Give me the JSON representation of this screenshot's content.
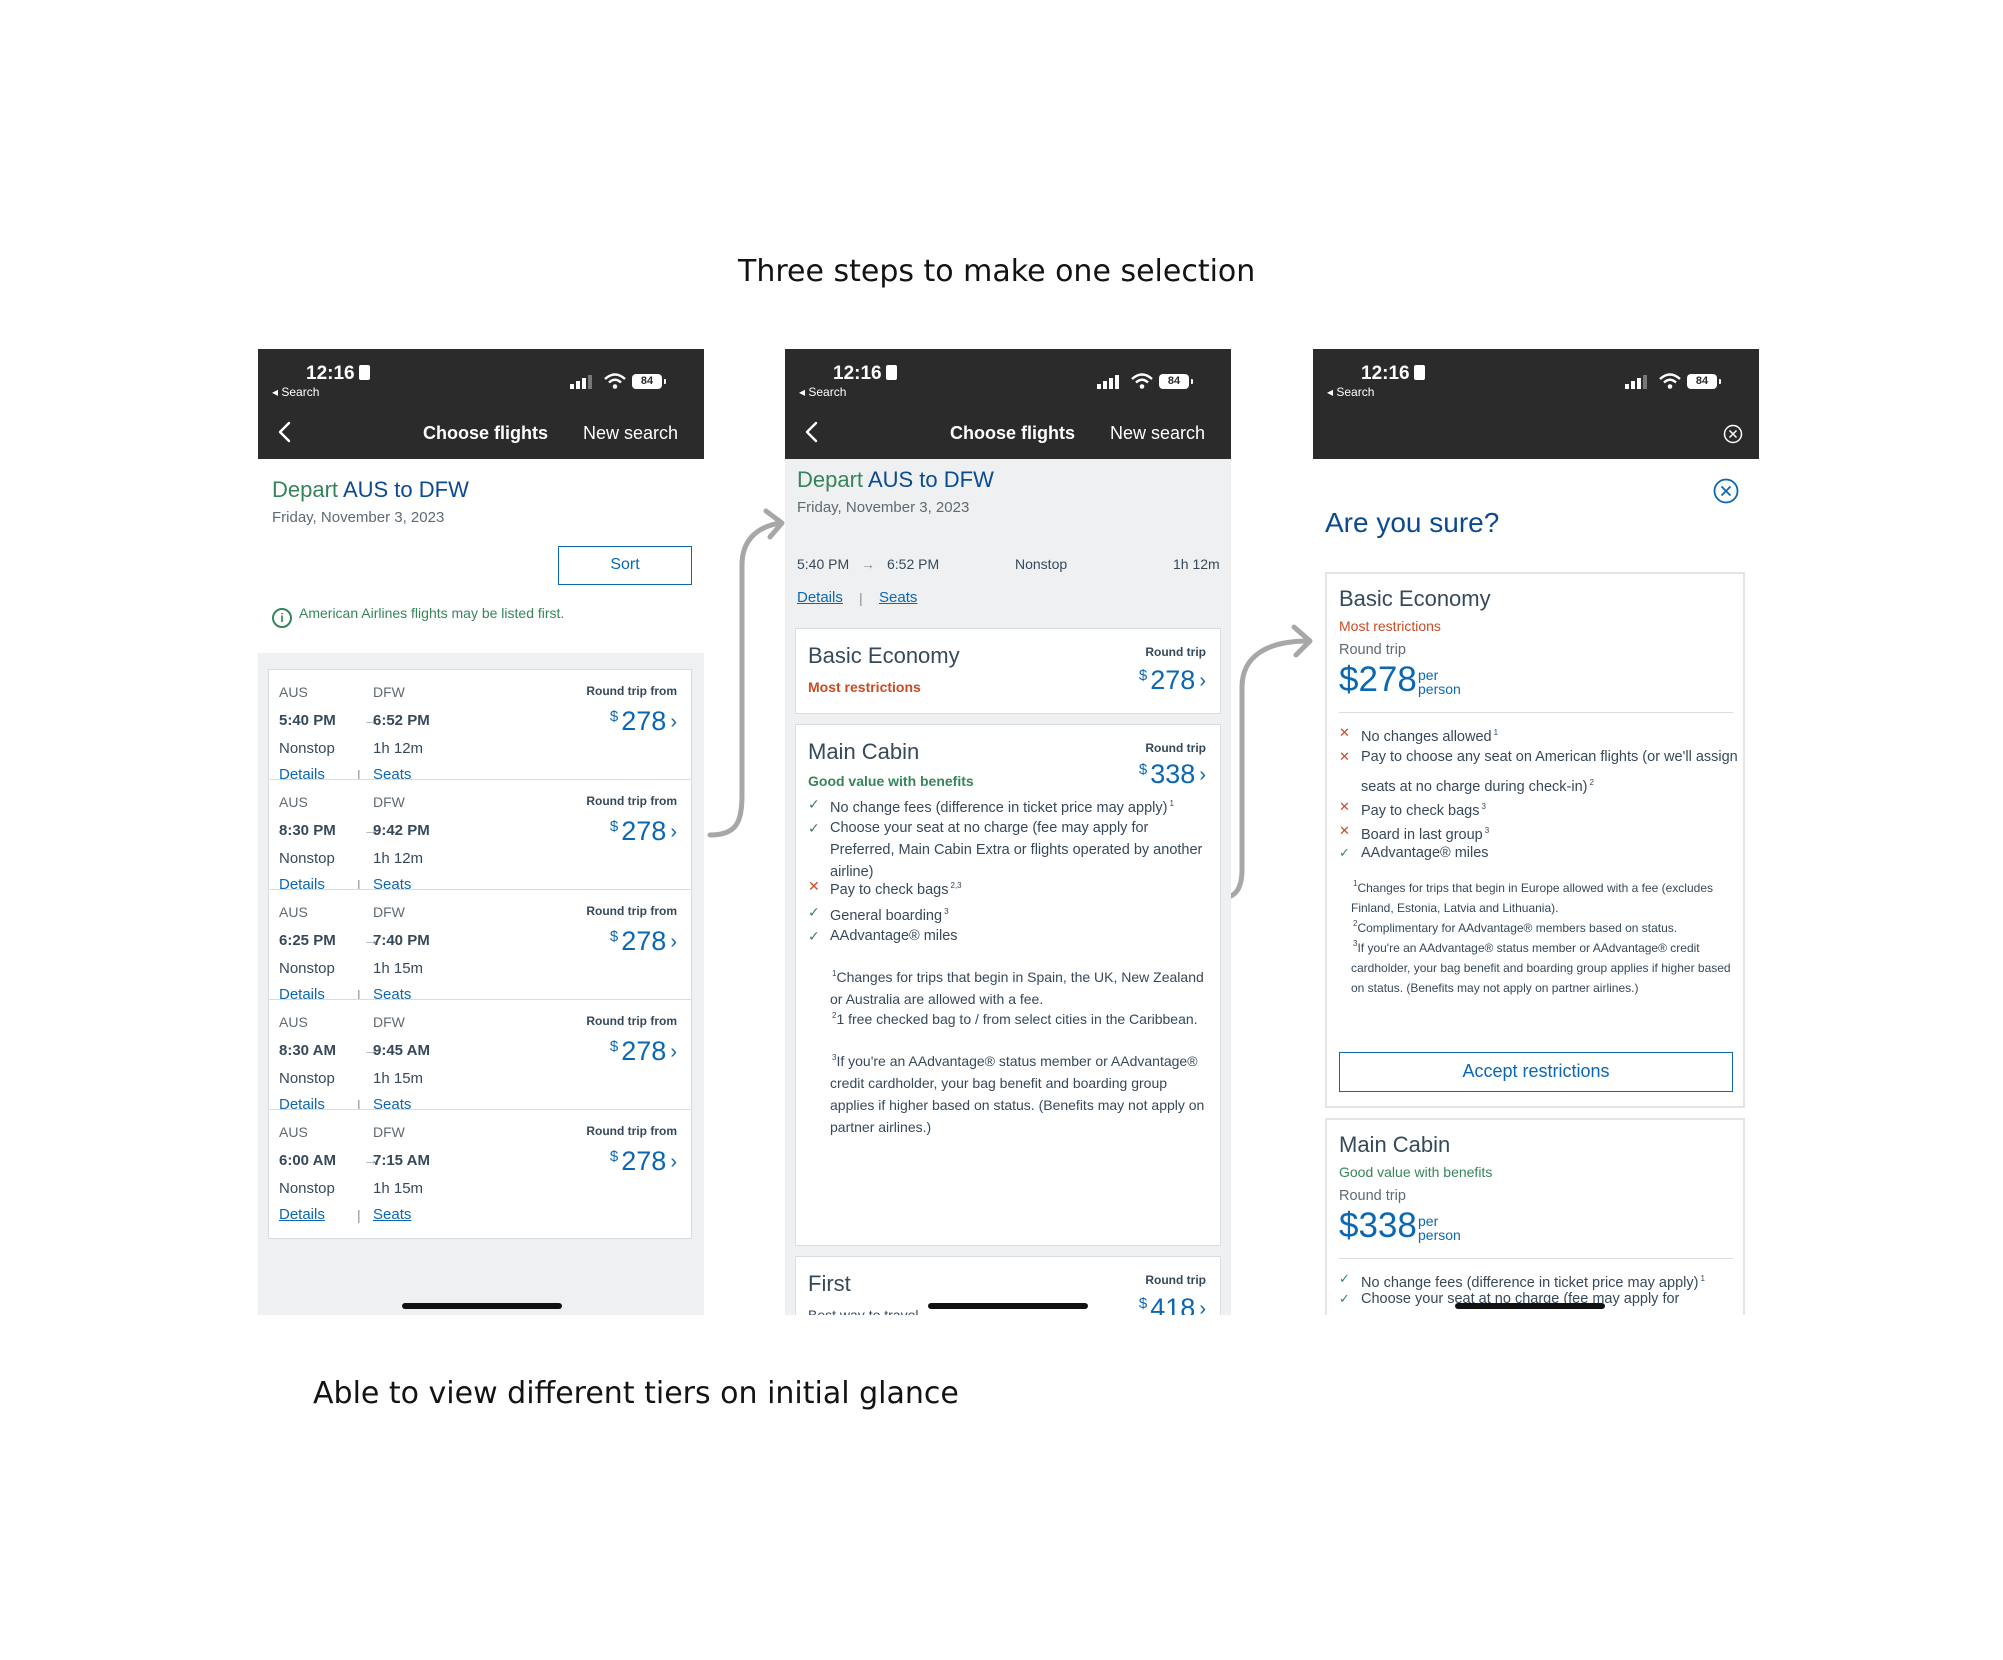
{
  "captions": {
    "top": "Three steps to make one selection",
    "bottom": "Able to view different tiers on initial glance"
  },
  "status_bar": {
    "time": "12:16",
    "back_app": "◂ Search",
    "battery": "84"
  },
  "nav": {
    "title": "Choose flights",
    "new_search": "New search"
  },
  "icons": {
    "back": "chevron-left-icon",
    "close": "close-circle-icon",
    "info": "info-icon",
    "check": "check-icon",
    "cross": "x-icon",
    "arrow": "arrow-right-icon"
  },
  "colors": {
    "accent": "#0b67b2",
    "green": "#36855a",
    "warning": "#c84b24",
    "nav_bg": "#2b2b2b"
  },
  "screen1": {
    "depart_prefix": "Depart",
    "route": "AUS to DFW",
    "date": "Friday, November 3, 2023",
    "sort_label": "Sort",
    "info_text": "American Airlines flights may be listed first.",
    "labels": {
      "from": "AUS",
      "to": "DFW",
      "round_trip": "Round trip from",
      "details": "Details",
      "seats": "Seats",
      "currency": "$",
      "separator": "|"
    },
    "flights": [
      {
        "dep": "5:40 PM",
        "arr": "6:52 PM",
        "stops": "Nonstop",
        "duration": "1h  12m",
        "price": "278"
      },
      {
        "dep": "8:30 PM",
        "arr": "9:42 PM",
        "stops": "Nonstop",
        "duration": "1h  12m",
        "price": "278"
      },
      {
        "dep": "6:25 PM",
        "arr": "7:40 PM",
        "stops": "Nonstop",
        "duration": "1h  15m",
        "price": "278"
      },
      {
        "dep": "8:30 AM",
        "arr": "9:45 AM",
        "stops": "Nonstop",
        "duration": "1h  15m",
        "price": "278"
      },
      {
        "dep": "6:00 AM",
        "arr": "7:15 AM",
        "stops": "Nonstop",
        "duration": "1h  15m",
        "price": "278"
      }
    ]
  },
  "screen2": {
    "depart_prefix": "Depart",
    "route": "AUS to DFW",
    "date": "Friday, November 3, 2023",
    "trip": {
      "dep": "5:40 PM",
      "arr": "6:52 PM",
      "stops": "Nonstop",
      "duration": "1h  12m"
    },
    "links": {
      "details": "Details",
      "seats": "Seats",
      "separator": "|"
    },
    "round_trip": "Round trip",
    "currency": "$",
    "basic": {
      "name": "Basic Economy",
      "tag": "Most restrictions",
      "price": "278"
    },
    "main": {
      "name": "Main Cabin",
      "tag": "Good value with benefits",
      "price": "338",
      "features": [
        {
          "ok": true,
          "text": "No change fees (difference in ticket price may apply)",
          "sup": "1"
        },
        {
          "ok": true,
          "text": "Choose your seat at no charge (fee may apply for Preferred, Main Cabin Extra or flights operated by another airline)",
          "sup": ""
        },
        {
          "ok": false,
          "text": "Pay to check bags",
          "sup": "2,3"
        },
        {
          "ok": true,
          "text": "General boarding",
          "sup": "3"
        },
        {
          "ok": true,
          "text": "AAdvantage® miles",
          "sup": ""
        }
      ],
      "notes": [
        {
          "sup": "1",
          "text": "Changes for trips that begin in Spain, the UK, New Zealand or Australia are allowed with a fee."
        },
        {
          "sup": "2",
          "text": "1 free checked bag to / from select cities in the Caribbean."
        },
        {
          "sup": "3",
          "text": "If you're an AAdvantage® status member or AAdvantage® credit cardholder, your bag benefit and boarding group applies if higher based on status. (Benefits may not apply on partner airlines.)"
        }
      ]
    },
    "first": {
      "name": "First",
      "tag": "Best way to travel",
      "price": "418"
    }
  },
  "screen3": {
    "title": "Are you sure?",
    "round_trip": "Round trip",
    "per_person": "per person",
    "currency": "$",
    "accept_label": "Accept restrictions",
    "basic": {
      "name": "Basic Economy",
      "tag": "Most restrictions",
      "price": "278",
      "features": [
        {
          "ok": false,
          "text": "No changes allowed",
          "sup": "1"
        },
        {
          "ok": false,
          "text": "Pay to choose any seat on American flights (or we'll assign seats at no charge during check-in)",
          "sup": "2"
        },
        {
          "ok": false,
          "text": "Pay to check bags",
          "sup": "3"
        },
        {
          "ok": false,
          "text": "Board in last group",
          "sup": "3"
        },
        {
          "ok": true,
          "text": "AAdvantage® miles",
          "sup": ""
        }
      ],
      "notes": [
        {
          "sup": "1",
          "text": "Changes for trips that begin in Europe allowed with a fee (excludes Finland, Estonia, Latvia and Lithuania)."
        },
        {
          "sup": "2",
          "text": "Complimentary for AAdvantage® members based on status."
        },
        {
          "sup": "3",
          "text": "If you're an AAdvantage® status member or AAdvantage® credit cardholder, your bag benefit and boarding group applies if higher based on status. (Benefits may not apply on partner airlines.)"
        }
      ]
    },
    "main": {
      "name": "Main Cabin",
      "tag": "Good value with benefits",
      "price": "338",
      "features": [
        {
          "ok": true,
          "text": "No change fees (difference in ticket price may apply)",
          "sup": "1"
        },
        {
          "ok": true,
          "text": "Choose your seat at no charge (fee may apply for",
          "sup": ""
        }
      ]
    }
  }
}
